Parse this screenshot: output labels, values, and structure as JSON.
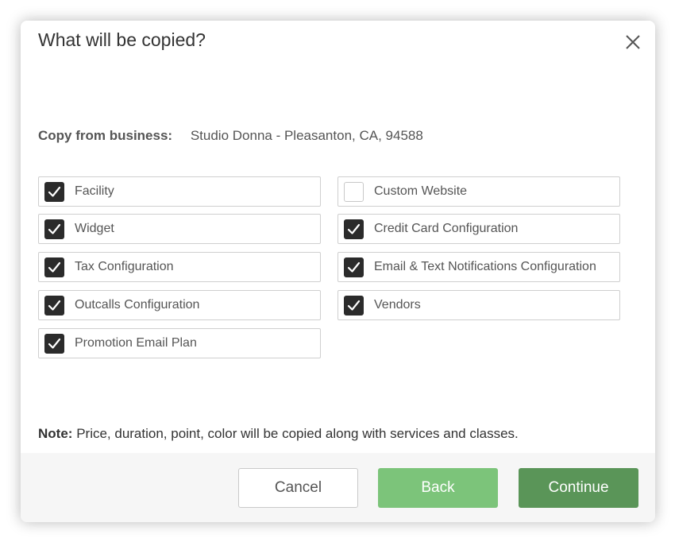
{
  "dialog": {
    "title": "What will be copied?",
    "close_icon": "close-icon"
  },
  "source": {
    "label": "Copy from business:",
    "value": "Studio Donna - Pleasanton, CA, 94588"
  },
  "options_left": [
    {
      "label": "Facility",
      "checked": true
    },
    {
      "label": "Widget",
      "checked": true
    },
    {
      "label": "Tax Configuration",
      "checked": true
    },
    {
      "label": "Outcalls Configuration",
      "checked": true
    },
    {
      "label": "Promotion Email Plan",
      "checked": true
    }
  ],
  "options_right": [
    {
      "label": "Custom Website",
      "checked": false
    },
    {
      "label": "Credit Card Configuration",
      "checked": true
    },
    {
      "label": "Email & Text Notifications Configuration",
      "checked": true
    },
    {
      "label": "Vendors",
      "checked": true
    }
  ],
  "note": {
    "label": "Note:",
    "text": "Price, duration, point, color will be copied along with services and classes."
  },
  "footer": {
    "cancel_label": "Cancel",
    "back_label": "Back",
    "continue_label": "Continue"
  },
  "colors": {
    "back_button": "#7cc47a",
    "continue_button": "#5a9558",
    "checkbox_checked": "#2b2b2b"
  }
}
